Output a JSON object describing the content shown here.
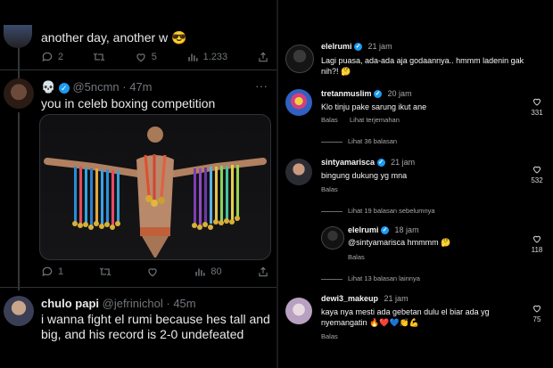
{
  "left": {
    "tweet1": {
      "text": "another day, another w 😎",
      "replies": "2",
      "likes": "5",
      "views": "1.233"
    },
    "tweet2": {
      "handle": "@5ncmn",
      "time": "· 47m",
      "text": "you in celeb boxing competition",
      "replies": "1",
      "views": "80"
    },
    "tweet3": {
      "name": "chulo papi",
      "handle": "@jefrinichol",
      "time": "· 45m",
      "line1": "i wanna fight el rumi because hes tall and",
      "line2": "big, and his record is 2-0 undefeated"
    }
  },
  "right": {
    "comments": [
      {
        "user": "elelrumi",
        "time": "21 jam",
        "text1": "Lagi puasa, ada-ada aja godaannya.. hmmm ladenin gak",
        "text2": "nih?! 🤔"
      },
      {
        "user": "tretanmuslim",
        "time": "20 jam",
        "text1": "Klo tinju pake sarung ikut ane",
        "reply": "Balas",
        "translate": "Lihat terjemahan",
        "likes": "331",
        "thread": "Lihat 36 balasan"
      },
      {
        "user": "sintyamarisca",
        "time": "21 jam",
        "text1": "bingung dukung yg mna",
        "reply": "Balas",
        "likes": "532",
        "thread": "Lihat 19 balasan sebelumnya"
      },
      {
        "user": "elelrumi",
        "time": "18 jam",
        "text1": "@sintyamarisca hmmmm 🤔",
        "reply": "Balas",
        "likes": "118",
        "thread": "Lihat 13 balasan lainnya"
      },
      {
        "user": "dewi3_makeup",
        "time": "21 jam",
        "text1": "kaya nya mesti ada gebetan dulu el biar ada yg",
        "text2": "nyemangatin 🔥❤️💙👏💪",
        "reply": "Balas",
        "likes": "75"
      }
    ]
  },
  "colors": {
    "verified": "#1d9bf0",
    "muted": "#71767b"
  }
}
